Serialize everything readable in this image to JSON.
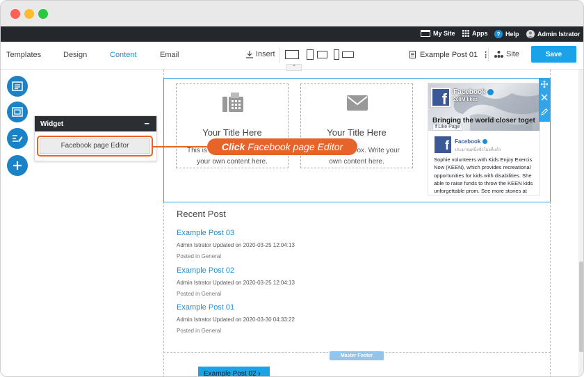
{
  "topbar": {
    "my_site": "My Site",
    "apps": "Apps",
    "help": "Help",
    "user": "Admin Istrator"
  },
  "toolbar": {
    "tabs": [
      {
        "label": "Templates"
      },
      {
        "label": "Design"
      },
      {
        "label": "Content"
      },
      {
        "label": "Email"
      }
    ],
    "insert_label": "Insert",
    "page_label": "Example Post 01",
    "site_label": "Site",
    "save_label": "Save"
  },
  "widget_panel": {
    "title": "Widget",
    "minimize": "−",
    "button_label": "Facebook page Editor"
  },
  "callout": {
    "prefix": "Click",
    "text": "Facebook page Editor"
  },
  "features": [
    {
      "title": "Your Title Here",
      "text_line1": "This is",
      "text_line2": "your own content here.",
      "icon": "fax-icon"
    },
    {
      "title": "Your Title Here",
      "text_line1": "ox. Write your",
      "text_line2": "own content here.",
      "icon": "envelope-icon"
    }
  ],
  "facebook": {
    "page_name": "Facebook",
    "likes": "208M likes",
    "cover_text": "Bringing the world closer toget",
    "like_page": "Like Page",
    "post_name": "Facebook",
    "post_sub": "ประมาณหนึ่งชั่วโมงที่แล้ว",
    "post_text": "Sophie volunteers with Kids Enjoy Exercis Now (KEEN), which provides recreational opportunities for kids with disabilities. She able to raise funds to throw the KEEN kids unforgettable prom. See more stories at"
  },
  "recent": {
    "title": "Recent Post",
    "posts": [
      {
        "title": "Example Post 03",
        "meta": "Admin Istrator Updated on 2020-03-25 12:04:13",
        "category": "Posted in General"
      },
      {
        "title": "Example Post 02",
        "meta": "Admin Istrator Updated on 2020-03-25 12:04:13",
        "category": "Posted in General"
      },
      {
        "title": "Example Post 01",
        "meta": "Admin Istrator Updated on 2020-03-30 04:33:22",
        "category": "Posted in General"
      }
    ]
  },
  "footer": {
    "master_footer": "Master Footer",
    "next_button": "Example Post 02"
  },
  "colors": {
    "accent": "#1a8fd6",
    "highlight": "#e6642a",
    "topbar": "#24282d"
  }
}
